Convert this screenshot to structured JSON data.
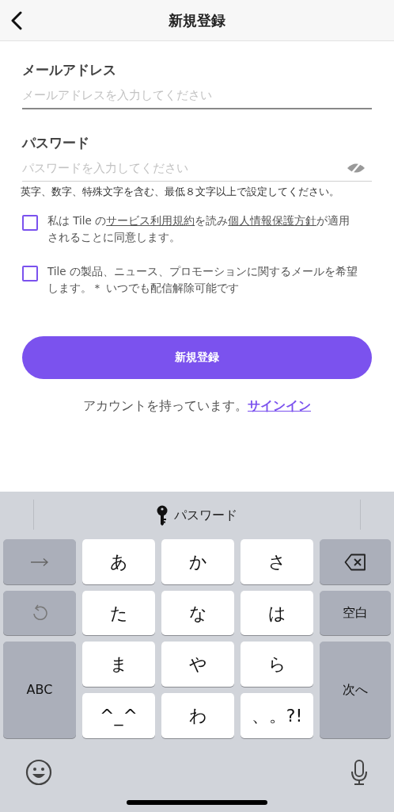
{
  "header": {
    "title": "新規登録"
  },
  "fields": [
    {
      "kind": "text",
      "label": "メールアドレス",
      "placeholder": "メールアドレスを入力してください"
    },
    {
      "kind": "password",
      "label": "パスワード",
      "placeholder": "パスワードを入力してください",
      "hint": "英字、数字、特殊文字を含む、最低８文字以上で設定してください。"
    }
  ],
  "consents": [
    {
      "checked": false,
      "segments": [
        {
          "text": "私は Tile の",
          "link": false
        },
        {
          "text": "サービス利用規約",
          "link": true
        },
        {
          "text": "を読み",
          "link": false
        },
        {
          "text": "個人情報保護方針",
          "link": true
        },
        {
          "text": "が適用されることに同意します。",
          "link": false
        }
      ]
    },
    {
      "checked": false,
      "segments": [
        {
          "text": "Tile の製品、ニュース、プロモーションに関するメールを希望します。＊ いつでも配信解除可能です",
          "link": false
        }
      ]
    }
  ],
  "submit_button": "新規登録",
  "signin_prompt": {
    "text": "アカウントを持っています。",
    "link": "サインイン"
  },
  "keyboard": {
    "suggestion": "パスワード",
    "keys": [
      {
        "kind": "icon"
      },
      {
        "kind": "kana",
        "label": "あ"
      },
      {
        "kind": "kana",
        "label": "か"
      },
      {
        "kind": "kana",
        "label": "さ"
      },
      {
        "kind": "icon"
      },
      {
        "kind": "icon"
      },
      {
        "kind": "kana",
        "label": "た"
      },
      {
        "kind": "kana",
        "label": "な"
      },
      {
        "kind": "kana",
        "label": "は"
      },
      {
        "kind": "function",
        "label": "空白"
      },
      {
        "kind": "tall",
        "label": "ABC"
      },
      {
        "kind": "kana",
        "label": "ま"
      },
      {
        "kind": "kana",
        "label": "や"
      },
      {
        "kind": "kana",
        "label": "ら"
      },
      {
        "kind": "tall",
        "label": "次へ"
      },
      {
        "kind": "kana",
        "label": "^_^"
      },
      {
        "kind": "kana",
        "label": "わ"
      },
      {
        "kind": "kana",
        "label": "、。?!"
      }
    ]
  }
}
